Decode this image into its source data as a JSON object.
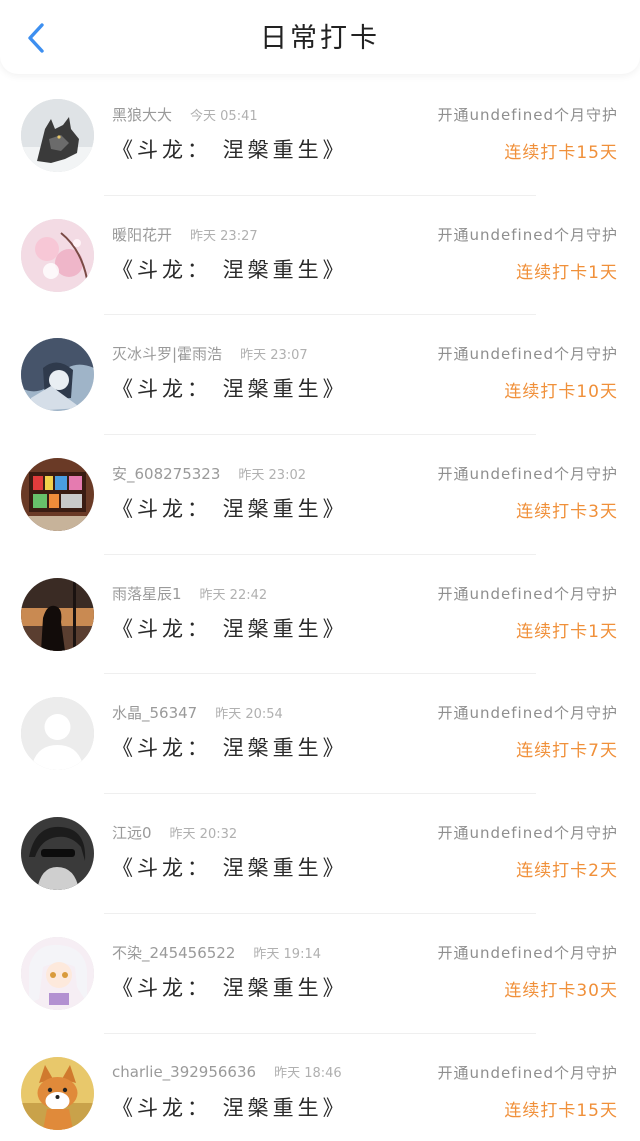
{
  "header": {
    "title": "日常打卡",
    "back_icon": "chevron-left-icon",
    "accent_color": "#3d8ff0"
  },
  "rows": [
    {
      "username": "黑狼大大",
      "time": "今天 05:41",
      "book": "《斗龙： 涅槃重生》",
      "guard": "开通undefined个月守护",
      "streak": "连续打卡15天",
      "avatar": "wolf"
    },
    {
      "username": "暖阳花开",
      "time": "昨天 23:27",
      "book": "《斗龙： 涅槃重生》",
      "guard": "开通undefined个月守护",
      "streak": "连续打卡1天",
      "avatar": "blossom"
    },
    {
      "username": "灭冰斗罗|霍雨浩",
      "time": "昨天 23:07",
      "book": "《斗龙： 涅槃重生》",
      "guard": "开通undefined个月守护",
      "streak": "连续打卡10天",
      "avatar": "anime-dark"
    },
    {
      "username": "安_608275323",
      "time": "昨天 23:02",
      "book": "《斗龙： 涅槃重生》",
      "guard": "开通undefined个月守护",
      "streak": "连续打卡3天",
      "avatar": "shelf"
    },
    {
      "username": "雨落星辰1",
      "time": "昨天 22:42",
      "book": "《斗龙： 涅槃重生》",
      "guard": "开通undefined个月守护",
      "streak": "连续打卡1天",
      "avatar": "sunset"
    },
    {
      "username": "水晶_56347",
      "time": "昨天 20:54",
      "book": "《斗龙： 涅槃重生》",
      "guard": "开通undefined个月守护",
      "streak": "连续打卡7天",
      "avatar": "default"
    },
    {
      "username": "江远0",
      "time": "昨天 20:32",
      "book": "《斗龙： 涅槃重生》",
      "guard": "开通undefined个月守护",
      "streak": "连续打卡2天",
      "avatar": "mono"
    },
    {
      "username": "不染_245456522",
      "time": "昨天 19:14",
      "book": "《斗龙： 涅槃重生》",
      "guard": "开通undefined个月守护",
      "streak": "连续打卡30天",
      "avatar": "anime-light"
    },
    {
      "username": "charlie_392956636",
      "time": "昨天 18:46",
      "book": "《斗龙： 涅槃重生》",
      "guard": "开通undefined个月守护",
      "streak": "连续打卡15天",
      "avatar": "corgi"
    }
  ],
  "colors": {
    "streak": "#f0903a",
    "meta": "#9a9a9a",
    "book": "#2a2a2a"
  }
}
